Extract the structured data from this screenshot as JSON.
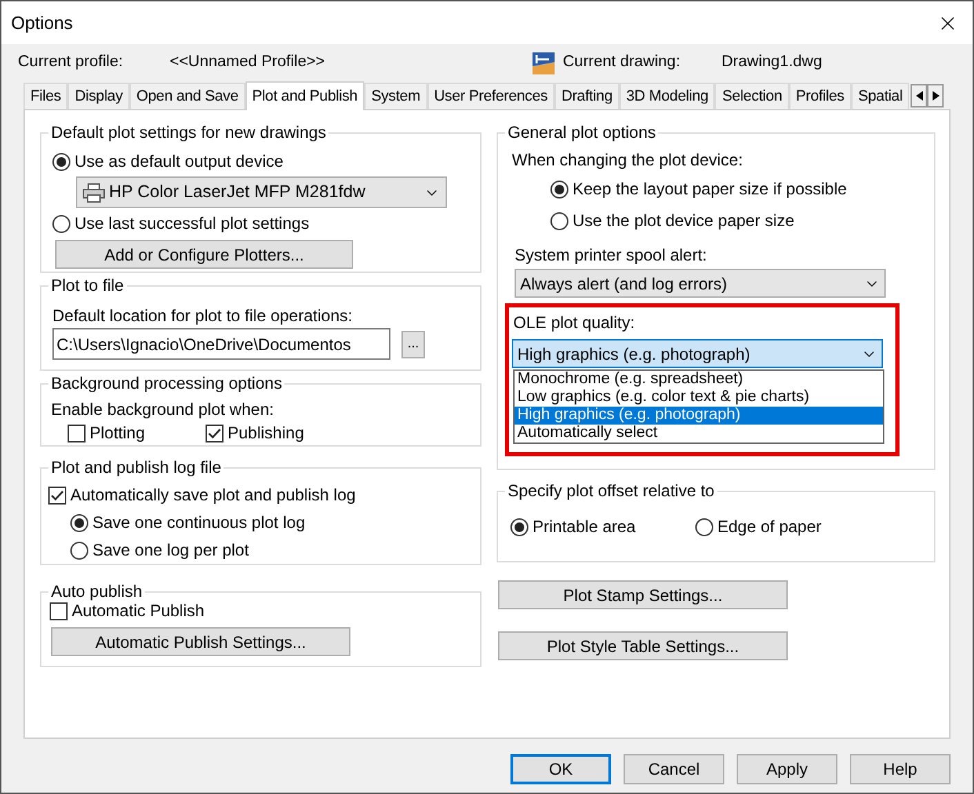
{
  "window": {
    "title": "Options"
  },
  "header": {
    "profile_label": "Current profile:",
    "profile_value": "<<Unnamed Profile>>",
    "drawing_label": "Current drawing:",
    "drawing_value": "Drawing1.dwg"
  },
  "tabs": [
    {
      "label": "Files",
      "selected": false
    },
    {
      "label": "Display",
      "selected": false
    },
    {
      "label": "Open and Save",
      "selected": false
    },
    {
      "label": "Plot and Publish",
      "selected": true
    },
    {
      "label": "System",
      "selected": false
    },
    {
      "label": "User Preferences",
      "selected": false
    },
    {
      "label": "Drafting",
      "selected": false
    },
    {
      "label": "3D Modeling",
      "selected": false
    },
    {
      "label": "Selection",
      "selected": false
    },
    {
      "label": "Profiles",
      "selected": false
    },
    {
      "label": "Spatial",
      "selected": false
    }
  ],
  "default_plot": {
    "title": "Default plot settings for new drawings",
    "options": [
      {
        "label": "Use as default output device",
        "selected": true
      },
      {
        "label": "Use last successful plot settings",
        "selected": false
      }
    ],
    "device": "HP Color LaserJet MFP M281fdw",
    "button": "Add or Configure Plotters..."
  },
  "plot_to_file": {
    "title": "Plot to file",
    "label": "Default location for plot to file operations:",
    "path": "C:\\Users\\Ignacio\\OneDrive\\Documentos",
    "browse": "..."
  },
  "background": {
    "title": "Background processing options",
    "label": "Enable background plot when:",
    "options": [
      {
        "label": "Plotting",
        "checked": false
      },
      {
        "label": "Publishing",
        "checked": true
      }
    ]
  },
  "log": {
    "title": "Plot and publish log file",
    "auto_save": {
      "label": "Automatically save plot and publish log",
      "checked": true
    },
    "options": [
      {
        "label": "Save one continuous plot log",
        "selected": true
      },
      {
        "label": "Save one log per plot",
        "selected": false
      }
    ]
  },
  "auto_publish": {
    "title": "Auto publish",
    "checkbox": {
      "label": "Automatic Publish",
      "checked": false
    },
    "button": "Automatic Publish Settings..."
  },
  "general": {
    "title": "General plot options",
    "device_label": "When changing the plot device:",
    "options": [
      {
        "label": "Keep the layout paper size if possible",
        "selected": true
      },
      {
        "label": "Use the plot device paper size",
        "selected": false
      }
    ],
    "spool_label": "System printer spool alert:",
    "spool_value": "Always alert (and log errors)",
    "ole_label": "OLE plot quality:",
    "ole_value": "High graphics (e.g. photograph)",
    "ole_list": [
      {
        "label": "Monochrome (e.g. spreadsheet)",
        "selected": false
      },
      {
        "label": "Low graphics (e.g. color text & pie charts)",
        "selected": false
      },
      {
        "label": "High graphics (e.g. photograph)",
        "selected": true
      },
      {
        "label": "Automatically select",
        "selected": false
      }
    ]
  },
  "offset": {
    "title": "Specify plot offset relative to",
    "options": [
      {
        "label": "Printable area",
        "selected": true
      },
      {
        "label": "Edge of paper",
        "selected": false
      }
    ]
  },
  "side_buttons": [
    "Plot Stamp Settings...",
    "Plot Style Table Settings..."
  ],
  "buttons": [
    {
      "label": "OK",
      "default": true
    },
    {
      "label": "Cancel",
      "default": false
    },
    {
      "label": "Apply",
      "default": false
    },
    {
      "label": "Help",
      "default": false
    }
  ]
}
